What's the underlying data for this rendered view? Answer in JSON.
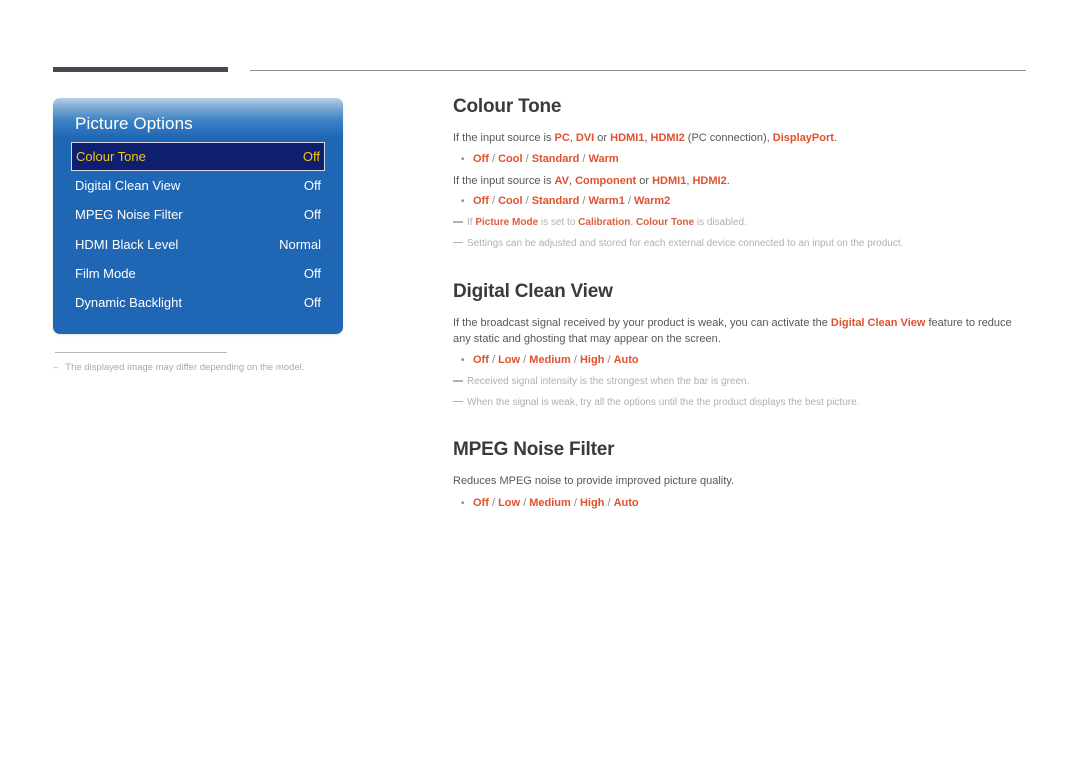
{
  "header": {
    "thick_rule_color": "#474756",
    "thin_rule_color": "#8d8d96"
  },
  "osd": {
    "title": "Picture Options",
    "accent_blue": "#1f66b5",
    "selected_bg": "#0d1f6e",
    "selected_text": "#f5c518",
    "rows": [
      {
        "label": "Colour Tone",
        "value": "Off",
        "selected": true
      },
      {
        "label": "Digital Clean View",
        "value": "Off",
        "selected": false
      },
      {
        "label": "MPEG Noise Filter",
        "value": "Off",
        "selected": false
      },
      {
        "label": "HDMI Black Level",
        "value": "Normal",
        "selected": false
      },
      {
        "label": "Film Mode",
        "value": "Off",
        "selected": false
      },
      {
        "label": "Dynamic Backlight",
        "value": "Off",
        "selected": false
      }
    ]
  },
  "caption": {
    "dash": "–",
    "text": "The displayed image may differ depending on the model."
  },
  "sections": {
    "colour_tone": {
      "title": "Colour Tone",
      "line1_pre": "If the input source is ",
      "line1_pc": "PC",
      "line1_sep1": ", ",
      "line1_dvi": "DVI",
      "line1_or": " or ",
      "line1_hdmi1": "HDMI1",
      "line1_sep2": ", ",
      "line1_hdmi2": "HDMI2",
      "line1_mid": " (PC connection), ",
      "line1_dp": "DisplayPort",
      "line1_end": ".",
      "bullet1": "•",
      "opts1": [
        "Off",
        "Cool",
        "Standard",
        "Warm"
      ],
      "line2_pre": "If the input source is ",
      "line2_av": "AV",
      "line2_sep1": ", ",
      "line2_component": "Component",
      "line2_or": " or ",
      "line2_hdmi1": "HDMI1",
      "line2_sep2": ", ",
      "line2_hdmi2": "HDMI2",
      "line2_end": ".",
      "bullet2": "•",
      "opts2": [
        "Off",
        "Cool",
        "Standard",
        "Warm1",
        "Warm2"
      ],
      "note1_pre": "If ",
      "note1_b1": "Picture Mode",
      "note1_mid1": " is set to ",
      "note1_b2": "Calibration",
      "note1_mid2": ", ",
      "note1_b3": "Colour Tone",
      "note1_end": " is disabled.",
      "note2": "Settings can be adjusted and stored for each external device connected to an input on the product."
    },
    "digital_clean_view": {
      "title": "Digital Clean View",
      "para_pre": "If the broadcast signal received by your product is weak, you can activate the ",
      "para_b": "Digital Clean View",
      "para_post": " feature to reduce any static and ghosting that may appear on the screen.",
      "bullet": "•",
      "opts": [
        "Off",
        "Low",
        "Medium",
        "High",
        "Auto"
      ],
      "note1": "Received signal intensity is the strongest when the bar is green.",
      "note2": "When the signal is weak, try all the options until the the product displays the best picture."
    },
    "mpeg_noise_filter": {
      "title": "MPEG Noise Filter",
      "para": "Reduces MPEG noise to provide improved picture quality.",
      "bullet": "•",
      "opts": [
        "Off",
        "Low",
        "Medium",
        "High",
        "Auto"
      ]
    }
  }
}
